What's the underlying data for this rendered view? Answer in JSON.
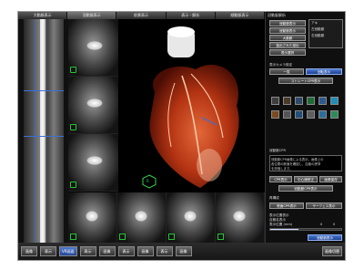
{
  "tabs": [
    "大動脈表示",
    "冠動脈表示",
    "前景表示",
    "表示・解析",
    "細動脈表示"
  ],
  "active_tab_index": 1,
  "panel": {
    "title": "冠動脈解析",
    "buttons_top": [
      "冠動脈表示",
      "冠動脈表示",
      "大動脈",
      "抽出された描出",
      "表示選択"
    ],
    "list_items": [
      "アキ",
      "左冠動脈",
      "右冠動脈"
    ],
    "section_label": "表示カメラ設定",
    "mode_buttons": [
      "一覧",
      "回転表示"
    ],
    "selected_mode": "回転表示",
    "wide_button": "ストレートCPR表示",
    "text_label": "冠動脈CPR",
    "text_lines": [
      "冠動脈CPR画像による表示。画像上の",
      "各位置の断面を確認し、血管の狭窄",
      "を評価します。"
    ],
    "buttons_mid": [
      "CPR表示",
      "中心線修正",
      "画像保存"
    ],
    "bottom_button": "冠動脈CPR表示",
    "sub_label": "再構成",
    "sub_buttons": [
      "断面CPR表示",
      "サーフェス表示"
    ],
    "check_labels": [
      "表示位置表示",
      "血管名表示",
      "表示位置 (mm)"
    ],
    "slider_labels": [
      "0",
      "0"
    ],
    "final_button": "冠動脈表示"
  },
  "status_buttons": [
    "画像",
    "表示",
    "VR画面",
    "表示",
    "画像",
    "表示",
    "画像",
    "表示",
    "画像"
  ],
  "status_right": "画像切替",
  "icons": [
    "wrench-icon",
    "brush-icon",
    "blur-icon",
    "eye-icon",
    "target-icon",
    "rotate-icon",
    "cube-icon",
    "ruler-icon",
    "camera-icon",
    "save-icon",
    "lightning-icon",
    "settings-icon"
  ],
  "colors": {
    "accent": "#2a58b8",
    "heart": "#b33312"
  }
}
